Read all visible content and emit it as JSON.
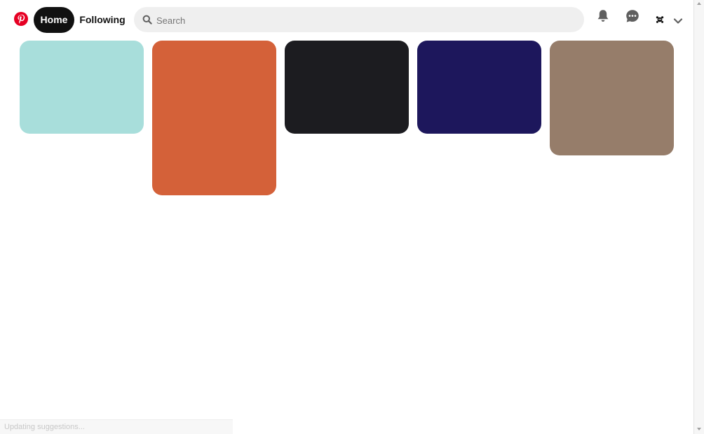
{
  "header": {
    "logo_icon": "pinterest-logo-icon",
    "nav": {
      "home_label": "Home",
      "following_label": "Following"
    },
    "search": {
      "placeholder": "Search",
      "value": "",
      "icon": "search-icon"
    },
    "icons": {
      "notifications": "bell-icon",
      "messages": "chat-bubble-icon",
      "account_menu": "chevron-down-icon"
    }
  },
  "pins": [
    {
      "color": "#a8dedb"
    },
    {
      "color": "#d46139"
    },
    {
      "color": "#1c1c20"
    },
    {
      "color": "#1d175c"
    },
    {
      "color": "#967d6a"
    }
  ],
  "status_bar": {
    "text": "Updating suggestions..."
  },
  "colors": {
    "brand": "#e60023",
    "active_nav_bg": "#111111",
    "search_bg": "#efefef"
  }
}
